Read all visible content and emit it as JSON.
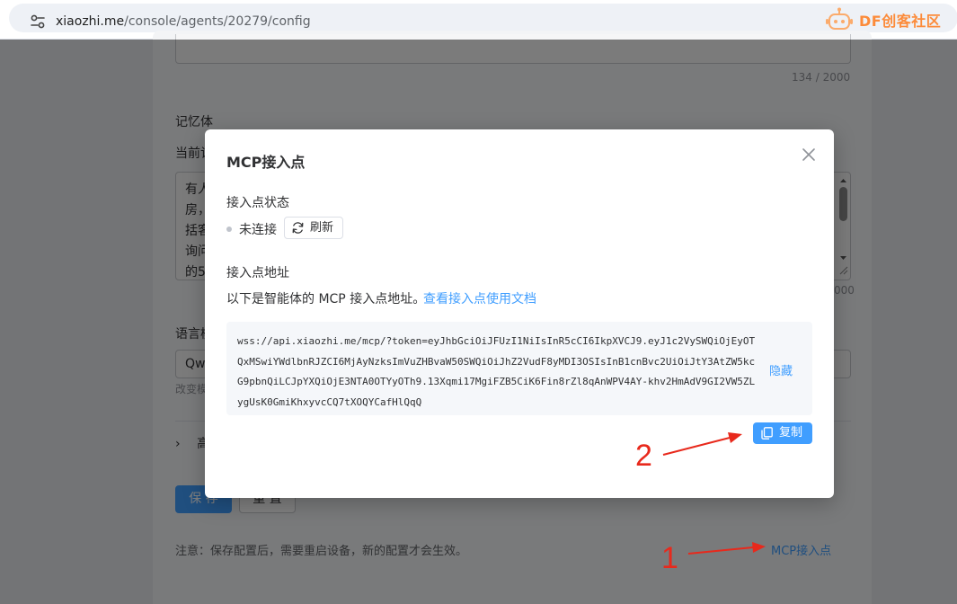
{
  "browser": {
    "url_host": "xiaozhi.me",
    "url_path": "/console/agents/20279/config",
    "watermark": "DF创客社区"
  },
  "background": {
    "top_counter": "134 / 2000",
    "memory_label": "记忆体",
    "memory_sublabel": "当前记",
    "memory_lines": [
      "有人",
      "房，",
      "括客",
      "询问",
      "的5"
    ],
    "memory_counter": "000",
    "language_label": "语言模",
    "language_value": "Qw",
    "language_hint": "改变模",
    "advanced_label": "高",
    "save_label": "保 存",
    "reset_label": "重 置",
    "note": "注意：保存配置后，需要重启设备，新的配置才会生效。",
    "mcp_link": "MCP接入点"
  },
  "modal": {
    "title": "MCP接入点",
    "status_label": "接入点状态",
    "status_value": "未连接",
    "refresh_label": "刷新",
    "address_label": "接入点地址",
    "description": "以下是智能体的 MCP 接入点地址。",
    "doc_link": "查看接入点使用文档",
    "endpoint_url": "wss://api.xiaozhi.me/mcp/?token=eyJhbGciOiJFUzI1NiIsInR5cCI6IkpXVCJ9.eyJ1c2VySWQiOjEyOTQxMSwiYWdlbnRJZCI6MjAyNzksImVuZHBvaW50SWQiOiJhZ2VudF8yMDI3OSIsInB1cnBvc2UiOiJtY3AtZW5kcG9pbnQiLCJpYXQiOjE3NTA0OTYyOTh9.13Xqmi17MgiFZB5CiK6Fin8rZl8qAnWPV4AY-khv2HmAdV9GI2VW5ZLygUsK0GmiKhxyvcCQ7tXOQYCafHlQqQ",
    "hide_label": "隐藏",
    "copy_label": "复制"
  },
  "annotations": {
    "step1": "1",
    "step2": "2",
    "color": "#e8291c"
  },
  "colors": {
    "primary": "#409eff",
    "overlay": "rgba(0,0,0,0.5)"
  }
}
